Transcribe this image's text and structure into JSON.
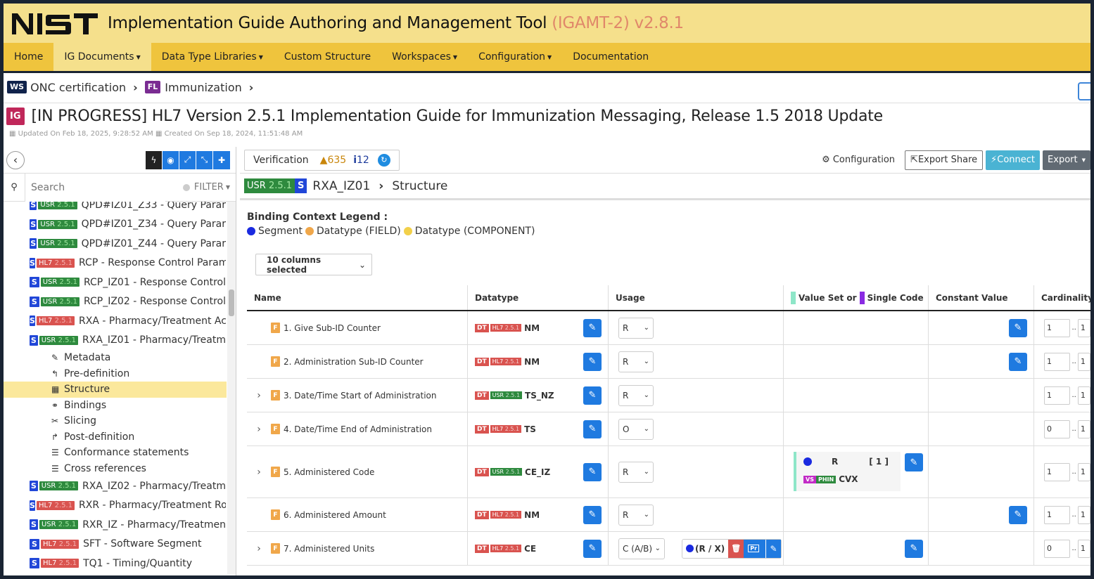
{
  "app": {
    "logo": "NIST",
    "title": "Implementation Guide Authoring and Management Tool",
    "version": "(IGAMT-2) v2.8.1"
  },
  "nav": {
    "items": [
      {
        "label": "Home",
        "caret": ""
      },
      {
        "label": "IG Documents",
        "caret": "▼"
      },
      {
        "label": "Data Type Libraries",
        "caret": "▼"
      },
      {
        "label": "Custom Structure",
        "caret": ""
      },
      {
        "label": "Workspaces",
        "caret": "▼"
      },
      {
        "label": "Configuration",
        "caret": "▼"
      },
      {
        "label": "Documentation",
        "caret": ""
      }
    ],
    "active": "IG Documents"
  },
  "breadcrumb": {
    "ws_badge": "WS",
    "workspace": "ONC certification",
    "fl_badge": "FL",
    "folder": "Immunization",
    "sep": "›"
  },
  "ig": {
    "badge": "IG",
    "title": "[IN PROGRESS] HL7 Version 2.5.1 Implementation Guide for Immunization Messaging, Release 1.5 2018 Update",
    "updated": "Updated On Feb 18, 2025, 9:28:52 AM",
    "created": "Created On Sep 18, 2024, 11:51:48 AM"
  },
  "sidebar": {
    "search_placeholder": "Search",
    "filter_label": "FILTER",
    "items": [
      {
        "s": "S",
        "scope": "USR",
        "ver": "2.5.1",
        "label": "QPD#IZ01_Z33 - Query Parar"
      },
      {
        "s": "S",
        "scope": "USR",
        "ver": "2.5.1",
        "label": "QPD#IZ01_Z34 - Query Parar"
      },
      {
        "s": "S",
        "scope": "USR",
        "ver": "2.5.1",
        "label": "QPD#IZ01_Z44 - Query Parar"
      },
      {
        "s": "S",
        "scope": "HL7",
        "ver": "2.5.1",
        "label": "RCP - Response Control Param"
      },
      {
        "s": "S",
        "scope": "USR",
        "ver": "2.5.1",
        "label": "RCP_IZ01 - Response Control"
      },
      {
        "s": "S",
        "scope": "USR",
        "ver": "2.5.1",
        "label": "RCP_IZ02 - Response Control"
      },
      {
        "s": "S",
        "scope": "HL7",
        "ver": "2.5.1",
        "label": "RXA - Pharmacy/Treatment Ac"
      },
      {
        "s": "S",
        "scope": "USR",
        "ver": "2.5.1",
        "label": "RXA_IZ01 - Pharmacy/Treatm"
      }
    ],
    "subitems": [
      {
        "icon": "✎",
        "label": "Metadata"
      },
      {
        "icon": "↰",
        "label": "Pre-definition"
      },
      {
        "icon": "▦",
        "label": "Structure"
      },
      {
        "icon": "⚭",
        "label": "Bindings"
      },
      {
        "icon": "✂",
        "label": "Slicing"
      },
      {
        "icon": "↱",
        "label": "Post-definition"
      },
      {
        "icon": "☰",
        "label": "Conformance statements"
      },
      {
        "icon": "☰",
        "label": "Cross references"
      }
    ],
    "items_after": [
      {
        "s": "S",
        "scope": "USR",
        "ver": "2.5.1",
        "label": "RXA_IZ02 - Pharmacy/Treatm"
      },
      {
        "s": "S",
        "scope": "HL7",
        "ver": "2.5.1",
        "label": "RXR - Pharmacy/Treatment Ro"
      },
      {
        "s": "S",
        "scope": "USR",
        "ver": "2.5.1",
        "label": "RXR_IZ - Pharmacy/Treatmen"
      },
      {
        "s": "S",
        "scope": "HL7",
        "ver": "2.5.1",
        "label": "SFT - Software Segment"
      },
      {
        "s": "S",
        "scope": "HL7",
        "ver": "2.5.1",
        "label": "TQ1 - Timing/Quantity"
      }
    ]
  },
  "verification": {
    "label": "Verification",
    "warnings": "635",
    "infos": "12"
  },
  "toolbar": {
    "configuration": "Configuration",
    "export_share": "Export Share",
    "connect": "Connect",
    "export": "Export"
  },
  "path": {
    "scope": "USR",
    "version": "2.5.1",
    "s": "S",
    "segment": "RXA_IZ01",
    "sep": "›",
    "page": "Structure"
  },
  "legend": {
    "title": "Binding Context Legend :",
    "segment": "Segment",
    "field": "Datatype (FIELD)",
    "component": "Datatype (COMPONENT)",
    "colors": {
      "segment": "#1a2ae0",
      "field": "#f0a74a",
      "component": "#f2d04a"
    }
  },
  "columns_selector": "10 columns selected",
  "table": {
    "headers": {
      "name": "Name",
      "datatype": "Datatype",
      "usage": "Usage",
      "valueset_a": "Value Set or",
      "valueset_b": "Single Code",
      "constant": "Constant Value",
      "cardinality": "Cardinality"
    },
    "rows": [
      {
        "name": "1. Give Sub-ID Counter",
        "expand": "",
        "dt_scope": "HL7",
        "dt_ver": "2.5.1",
        "dt": "NM",
        "usage": "R",
        "min": "1",
        "max": "1"
      },
      {
        "name": "2. Administration Sub-ID Counter",
        "expand": "",
        "dt_scope": "HL7",
        "dt_ver": "2.5.1",
        "dt": "NM",
        "usage": "R",
        "min": "1",
        "max": "1"
      },
      {
        "name": "3. Date/Time Start of Administration",
        "expand": "›",
        "dt_scope": "USR",
        "dt_ver": "2.5.1",
        "dt": "TS_NZ",
        "usage": "R",
        "min": "1",
        "max": "1"
      },
      {
        "name": "4. Date/Time End of Administration",
        "expand": "›",
        "dt_scope": "HL7",
        "dt_ver": "2.5.1",
        "dt": "TS",
        "usage": "O",
        "min": "0",
        "max": "1"
      },
      {
        "name": "5. Administered Code",
        "expand": "›",
        "dt_scope": "USR",
        "dt_ver": "2.5.1",
        "dt": "CE_IZ",
        "usage": "R",
        "min": "1",
        "max": "1",
        "vs": {
          "strength": "R",
          "card": "[ 1 ]",
          "vs_badge": "VS",
          "source": "PHIN",
          "name": "CVX"
        }
      },
      {
        "name": "6. Administered Amount",
        "expand": "",
        "dt_scope": "HL7",
        "dt_ver": "2.5.1",
        "dt": "NM",
        "usage": "R",
        "min": "1",
        "max": "1"
      },
      {
        "name": "7. Administered Units",
        "expand": "›",
        "dt_scope": "HL7",
        "dt_ver": "2.5.1",
        "dt": "CE",
        "usage": "C (A/B)",
        "min": "0",
        "max": "1",
        "cond": {
          "label": "(R / X)",
          "pr": "Pr"
        }
      }
    ],
    "dt_label": "DT",
    "f_label": "F",
    "dots": ".."
  }
}
